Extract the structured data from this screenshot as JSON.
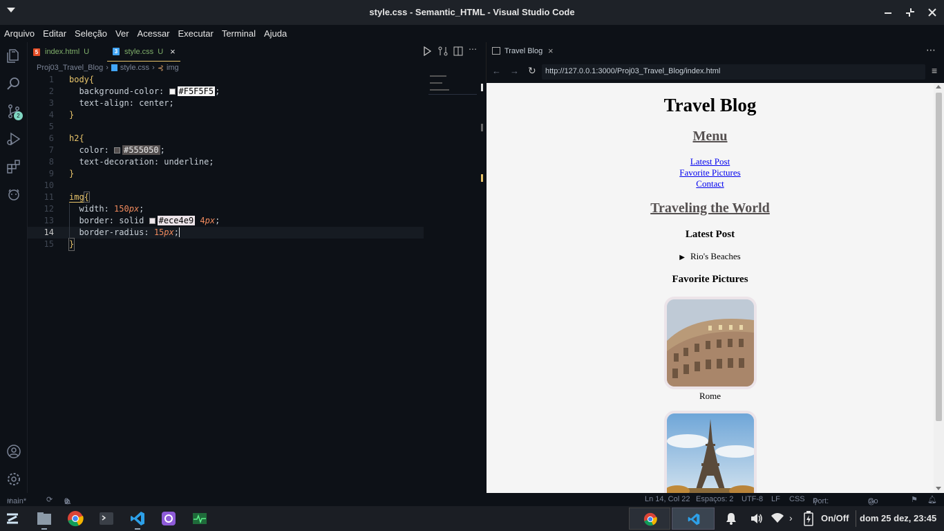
{
  "window": {
    "title": "style.css - Semantic_HTML - Visual Studio Code"
  },
  "menu": [
    "Arquivo",
    "Editar",
    "Seleção",
    "Ver",
    "Acessar",
    "Executar",
    "Terminal",
    "Ajuda"
  ],
  "activity": {
    "source_control_badge": "2"
  },
  "tabs": [
    {
      "name": "index.html",
      "status": "U",
      "icon": "html-icon",
      "icon_color": "#e44d26"
    },
    {
      "name": "style.css",
      "status": "U",
      "icon": "css-icon",
      "icon_color": "#42a5f5",
      "active": true
    }
  ],
  "breadcrumb": [
    "Proj03_Travel_Blog",
    "style.css",
    "img"
  ],
  "code": {
    "lines": [
      {
        "n": "1"
      },
      {
        "n": "2"
      },
      {
        "n": "3"
      },
      {
        "n": "4"
      },
      {
        "n": "5"
      },
      {
        "n": "6"
      },
      {
        "n": "7"
      },
      {
        "n": "8"
      },
      {
        "n": "9"
      },
      {
        "n": "10"
      },
      {
        "n": "11"
      },
      {
        "n": "12"
      },
      {
        "n": "13"
      },
      {
        "n": "14"
      },
      {
        "n": "15"
      }
    ],
    "l1_sel": "body",
    "l1_brace": "{",
    "l2_prop": "background-color: ",
    "l2_val": "#F5F5F5",
    "l2_end": ";",
    "l3": "text-align: center;",
    "l4": "}",
    "l6_sel": "h2",
    "l6_brace": "{",
    "l7_prop": "color: ",
    "l7_val": "#555050",
    "l7_end": ";",
    "l8": "text-decoration: underline;",
    "l9": "}",
    "l11_sel": "img",
    "l11_brace": "{",
    "l12_prop": "width: ",
    "l12_num": "150",
    "l12_unit": "px",
    "l12_end": ";",
    "l13_prop": "border: solid ",
    "l13_val": "#ece4e9",
    "l13_num": " 4",
    "l13_unit": "px",
    "l13_end": ";",
    "l14_prop": "border-radius: ",
    "l14_num": "15",
    "l14_unit": "px",
    "l14_end": ";",
    "l15": "}"
  },
  "browser": {
    "tab_title": "Travel Blog",
    "url": "http://127.0.0.1:3000/Proj03_Travel_Blog/index.html",
    "page": {
      "h1": "Travel Blog",
      "menu_heading": "Menu",
      "links": [
        "Latest Post",
        "Favorite Pictures",
        "Contact"
      ],
      "section_heading": "Traveling the World",
      "latest_post_heading": "Latest Post",
      "details_summary": "Rio's Beaches",
      "favorites_heading": "Favorite Pictures",
      "captions": [
        "Rome",
        ""
      ]
    }
  },
  "status": {
    "branch": "main*",
    "errors": "0",
    "warnings": "0",
    "position": "Ln 14, Col 22",
    "spaces": "Espaços: 2",
    "encoding": "UTF-8",
    "eol": "LF",
    "language": "CSS",
    "port": "Port: 3000",
    "golive": "Go Live"
  },
  "taskbar": {
    "power_label": "On/Off",
    "clock": "dom 25 dez, 23:45"
  },
  "colors": {
    "page_bg": "#F5F5F5",
    "h2_color": "#555050",
    "img_border": "#ece4e9",
    "link": "#0000ee"
  }
}
